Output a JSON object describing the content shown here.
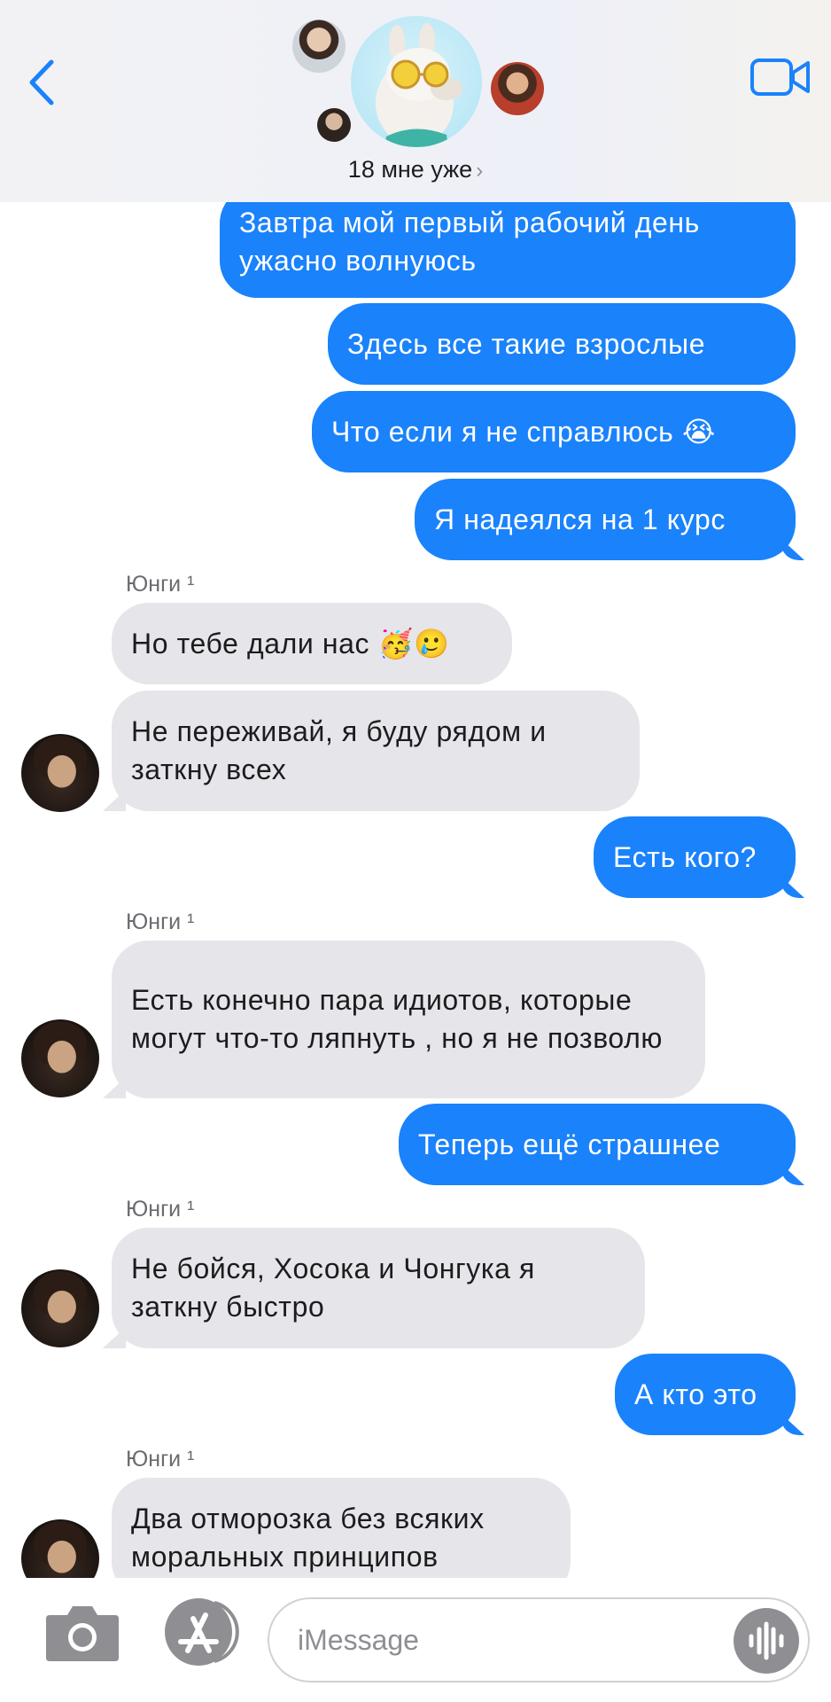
{
  "header": {
    "group_name": "18 мне уже",
    "chevron": "›",
    "back_icon": "chevron-left-icon",
    "video_icon": "video-camera-icon",
    "accent": "#1a82fb"
  },
  "messages": [
    {
      "dir": "out",
      "text": "Завтра мой первый рабочий день ужасно волнуюсь"
    },
    {
      "dir": "out",
      "text": "Здесь все такие взрослые"
    },
    {
      "dir": "out",
      "text": "Что если я не справлюсь 😭"
    },
    {
      "dir": "out",
      "text": "Я надеялся на 1 курс"
    },
    {
      "sender": "Юнги ¹"
    },
    {
      "dir": "in",
      "text": "Но тебе дали нас 🥳🥲"
    },
    {
      "dir": "in",
      "text": "Не переживай, я буду рядом и заткну всех"
    },
    {
      "dir": "out",
      "text": "Есть кого?"
    },
    {
      "sender": "Юнги ¹"
    },
    {
      "dir": "in",
      "text": "Есть конечно пара идиотов, которые могут что-то ляпнуть , но я не позволю"
    },
    {
      "dir": "out",
      "text": "Теперь ещё страшнее"
    },
    {
      "sender": "Юнги ¹"
    },
    {
      "dir": "in",
      "text": "Не бойся,  Хосока и Чонгука  я заткну быстро"
    },
    {
      "dir": "out",
      "text": "А кто это"
    },
    {
      "sender": "Юнги ¹"
    },
    {
      "dir": "in",
      "text": "Два отморозка без всяких моральных принципов"
    }
  ],
  "input": {
    "placeholder": "iMessage",
    "camera_icon": "camera-icon",
    "appstore_icon": "app-store-icon",
    "voice_icon": "waveform-icon"
  },
  "colors": {
    "outgoing_bubble": "#1a82fb",
    "incoming_bubble": "#e5e5ea"
  }
}
